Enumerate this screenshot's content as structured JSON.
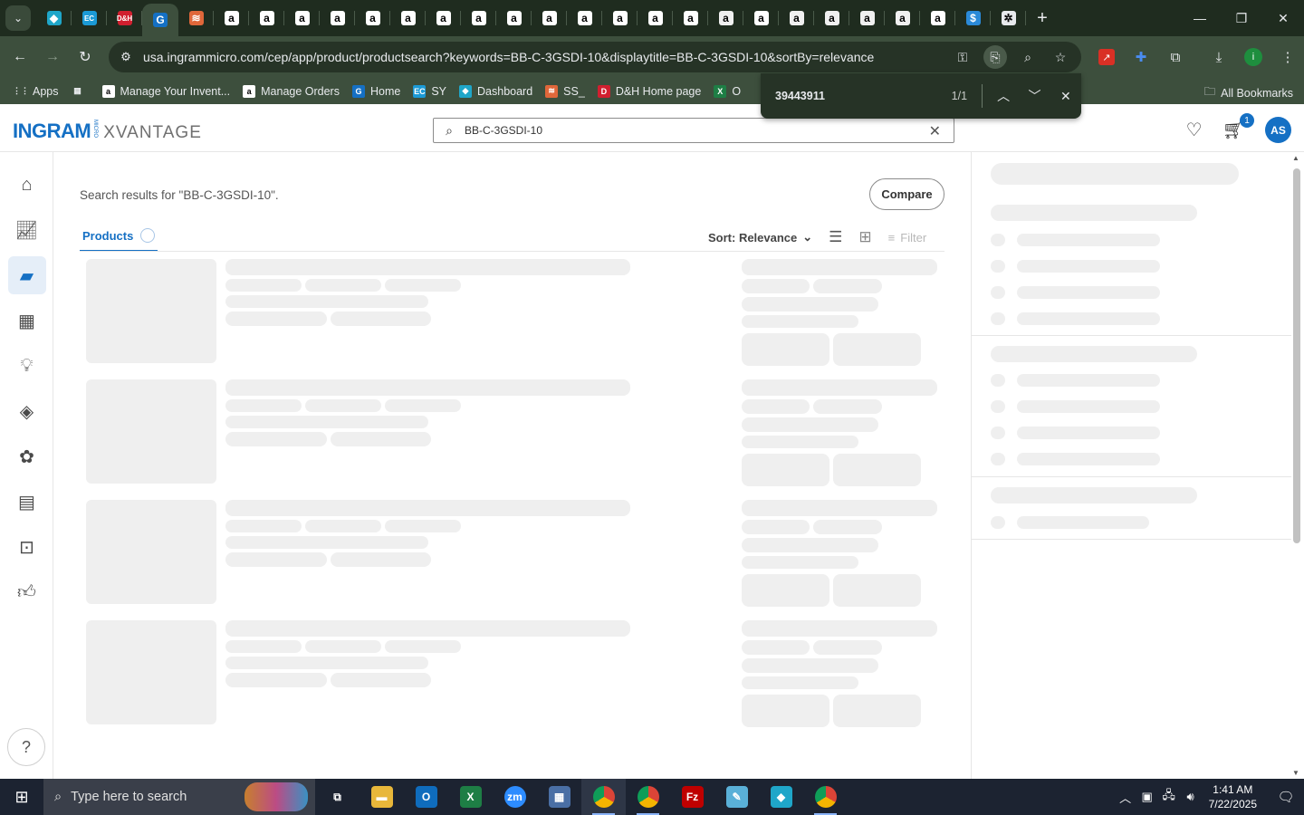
{
  "browser": {
    "tabs": [
      {
        "icon": "dashboard-tab-icon",
        "glyph": "◆",
        "color": "#1fa6c9"
      },
      {
        "icon": "ec-tab-icon",
        "glyph": "EC",
        "color": "#1b9ad6"
      },
      {
        "icon": "dh-tab-icon",
        "glyph": "D&H",
        "color": "#d11f2f"
      },
      {
        "icon": "ingram-tab-icon",
        "glyph": "G",
        "color": "#1570c4",
        "active": true
      },
      {
        "icon": "ss-tab-icon",
        "glyph": "≋",
        "color": "#e0673a"
      },
      {
        "icon": "amazon-tab-icon",
        "glyph": "a",
        "color": "#ffffff"
      },
      {
        "icon": "amazon-tab-icon",
        "glyph": "a",
        "color": "#ffffff"
      },
      {
        "icon": "amazon-tab-icon",
        "glyph": "a",
        "color": "#ffffff"
      },
      {
        "icon": "amazon-tab-icon",
        "glyph": "a",
        "color": "#ffffff"
      },
      {
        "icon": "amazon-tab-icon",
        "glyph": "a",
        "color": "#ffffff"
      },
      {
        "icon": "amazon-tab-icon",
        "glyph": "a",
        "color": "#ffffff"
      },
      {
        "icon": "amazon-tab-icon",
        "glyph": "a",
        "color": "#ffffff"
      },
      {
        "icon": "amazon-tab-icon",
        "glyph": "a",
        "color": "#ffffff"
      },
      {
        "icon": "amazon-tab-icon",
        "glyph": "a",
        "color": "#ffffff"
      },
      {
        "icon": "amazon-tab-icon",
        "glyph": "a",
        "color": "#ffffff"
      },
      {
        "icon": "amazon-tab-icon",
        "glyph": "a",
        "color": "#ffffff"
      },
      {
        "icon": "amazon-tab-icon",
        "glyph": "a",
        "color": "#ffffff"
      },
      {
        "icon": "amazon-tab-icon",
        "glyph": "a",
        "color": "#ffffff"
      },
      {
        "icon": "amazon-tab-icon",
        "glyph": "a",
        "color": "#ffffff"
      },
      {
        "icon": "amazon-seller-tab-icon",
        "glyph": "a",
        "color": "#f0f0f0"
      },
      {
        "icon": "amazon-tab-icon",
        "glyph": "a",
        "color": "#ffffff"
      },
      {
        "icon": "amazon-seller-tab-icon",
        "glyph": "a",
        "color": "#f0f0f0"
      },
      {
        "icon": "amazon-seller-tab-icon",
        "glyph": "a",
        "color": "#f0f0f0"
      },
      {
        "icon": "amazon-seller-tab-icon",
        "glyph": "a",
        "color": "#f0f0f0"
      },
      {
        "icon": "amazon-seller-tab-icon",
        "glyph": "a",
        "color": "#f0f0f0"
      },
      {
        "icon": "amazon-tab-icon",
        "glyph": "a",
        "color": "#ffffff"
      },
      {
        "icon": "dollar-tab-icon",
        "glyph": "$",
        "color": "#2b8ad8"
      },
      {
        "icon": "openai-tab-icon",
        "glyph": "✲",
        "color": "#e8eaed"
      }
    ],
    "url": "usa.ingrammicro.com/cep/app/product/productsearch?keywords=BB-C-3GSDI-10&displaytitle=BB-C-3GSDI-10&sortBy=relevance",
    "bookmarks": [
      {
        "label": "Apps",
        "icon": "apps-grid-icon",
        "glyph": "⋮⋮",
        "color": "#e8eaed"
      },
      {
        "label": "",
        "icon": "tab-group-icon",
        "glyph": "▦",
        "color": "#e8eaed"
      },
      {
        "label": "Manage Your Invent...",
        "icon": "amazon-bookmark-icon",
        "glyph": "a",
        "color": "#ffffff"
      },
      {
        "label": "Manage Orders",
        "icon": "amazon-bookmark-icon",
        "glyph": "a",
        "color": "#ffffff"
      },
      {
        "label": "Home",
        "icon": "ingram-bookmark-icon",
        "glyph": "G",
        "color": "#1570c4"
      },
      {
        "label": "SY",
        "icon": "ec-bookmark-icon",
        "glyph": "EC",
        "color": "#1b9ad6"
      },
      {
        "label": "Dashboard",
        "icon": "dashboard-bookmark-icon",
        "glyph": "◆",
        "color": "#1fa6c9"
      },
      {
        "label": "SS_",
        "icon": "ss-bookmark-icon",
        "glyph": "≋",
        "color": "#e0673a"
      },
      {
        "label": "D&H Home page",
        "icon": "dh-bookmark-icon",
        "glyph": "D",
        "color": "#d11f2f"
      },
      {
        "label": "O",
        "icon": "excel-bookmark-icon",
        "glyph": "X",
        "color": "#1e7e45"
      }
    ],
    "all_bookmarks": "All Bookmarks",
    "find": {
      "query": "39443911",
      "count": "1/1"
    }
  },
  "header": {
    "logo_main": "INGRAM",
    "logo_micro": "MICRO",
    "logo_product": "XVANTAGE",
    "search_value": "BB-C-3GSDI-10",
    "cart_count": "1",
    "avatar_initials": "AS"
  },
  "main": {
    "results_text": "Search results for \"BB-C-3GSDI-10\".",
    "compare_label": "Compare",
    "tab_products": "Products",
    "sort_label": "Sort: Relevance",
    "filter_label": "Filter"
  },
  "taskbar": {
    "search_placeholder": "Type here to search",
    "time": "1:41 AM",
    "date": "7/22/2025"
  }
}
